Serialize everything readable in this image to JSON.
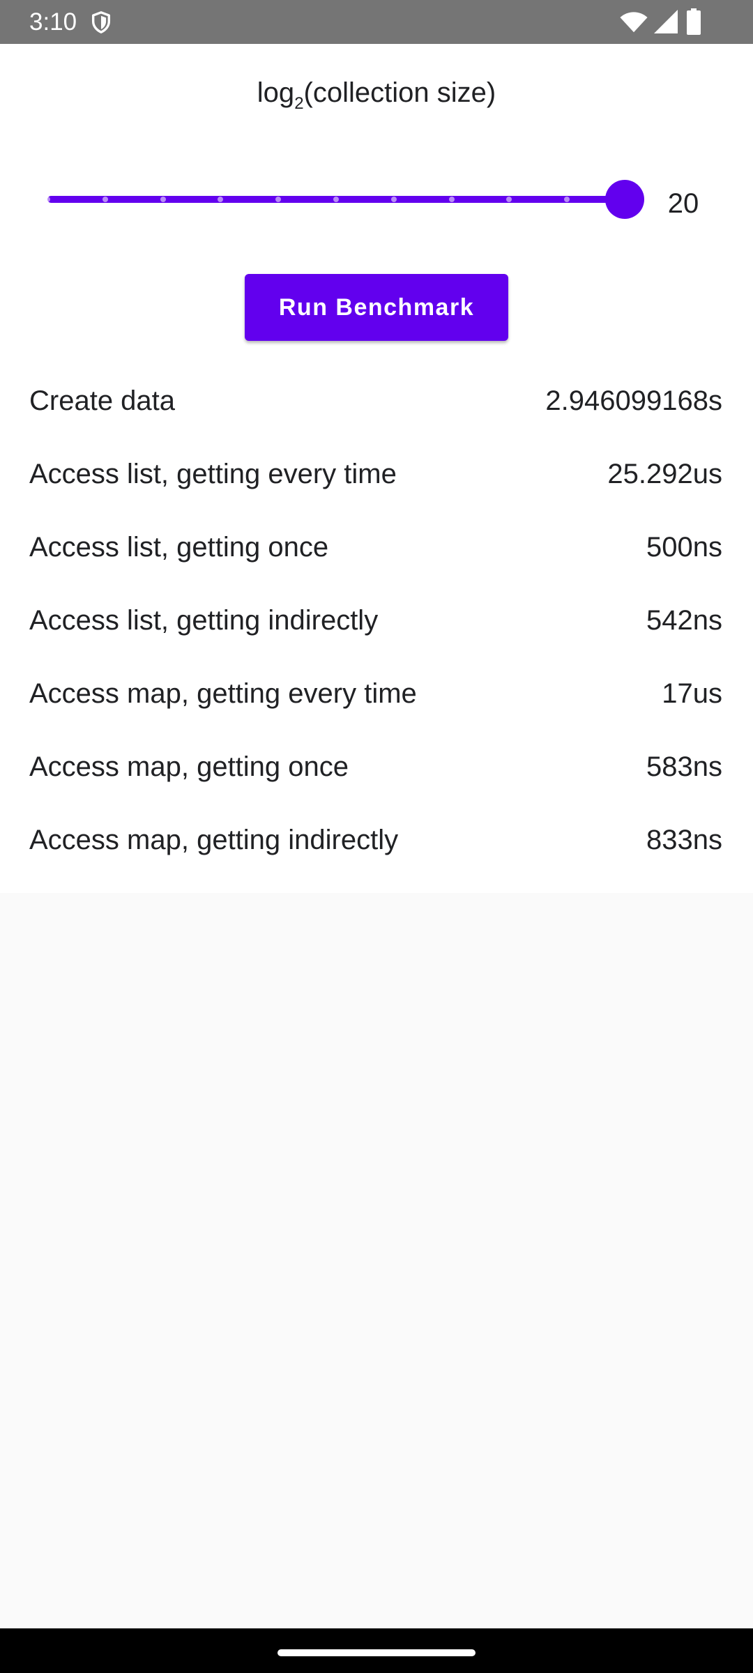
{
  "status_bar": {
    "time": "3:10",
    "icons": [
      "shield-icon",
      "wifi-icon",
      "signal-icon",
      "battery-icon"
    ]
  },
  "slider": {
    "label_prefix": "log",
    "label_base": "2",
    "label_suffix": "(collection size)",
    "value": "20",
    "fraction": 1.0,
    "steps": 10,
    "accent": "#6200ee"
  },
  "run_button": {
    "label": "Run Benchmark"
  },
  "results": [
    {
      "label": "Create data",
      "value": "2.946099168s"
    },
    {
      "label": "Access list, getting every time",
      "value": "25.292us"
    },
    {
      "label": "Access list, getting once",
      "value": "500ns"
    },
    {
      "label": "Access list, getting indirectly",
      "value": "542ns"
    },
    {
      "label": "Access map, getting every time",
      "value": "17us"
    },
    {
      "label": "Access map, getting once",
      "value": "583ns"
    },
    {
      "label": "Access map, getting indirectly",
      "value": "833ns"
    }
  ],
  "colors": {
    "status_bar": "#757575",
    "content_bg": "#ffffff",
    "page_bg": "#fafafa",
    "nav_bar": "#000000"
  }
}
